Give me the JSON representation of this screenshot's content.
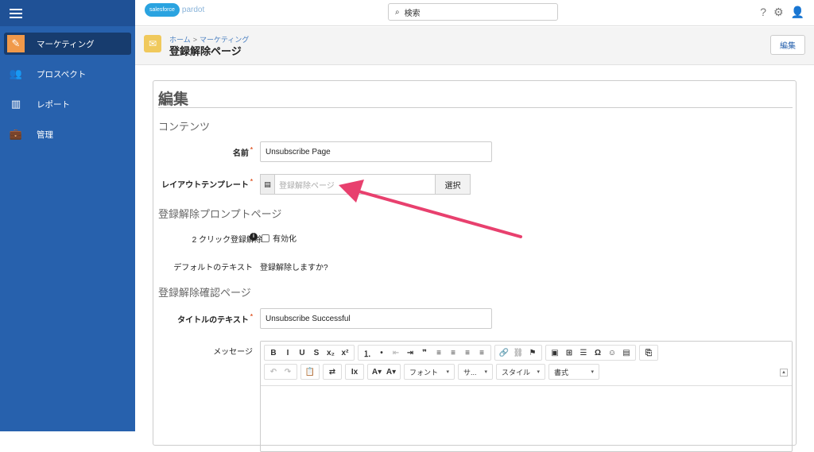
{
  "topbar": {
    "logo_cloud": "salesforce",
    "logo_product": "pardot",
    "search_placeholder": "検索",
    "help_icon": "?",
    "gear_icon": "⚙",
    "user_icon": "👤"
  },
  "sidebar": {
    "items": [
      {
        "label": "マーケティング",
        "icon": "✎",
        "active": true
      },
      {
        "label": "プロスペクト",
        "icon": "👥"
      },
      {
        "label": "レポート",
        "icon": "▥"
      },
      {
        "label": "管理",
        "icon": "💼"
      }
    ]
  },
  "header": {
    "breadcrumb": [
      "ホーム",
      "マーケティング"
    ],
    "breadcrumb_sep": ">",
    "title": "登録解除ページ",
    "edit_button": "編集"
  },
  "form": {
    "heading": "編集",
    "section_content": "コンテンツ",
    "name_label": "名前",
    "name_value": "Unsubscribe Page",
    "layout_label": "レイアウトテンプレート",
    "layout_placeholder": "登録解除ページ",
    "layout_select": "選択",
    "section_prompt": "登録解除プロンプトページ",
    "two_click_label": "2 クリック登録解除",
    "two_click_checkbox": "有効化",
    "default_text_label": "デフォルトのテキスト",
    "default_text_value": "登録解除しますか?",
    "section_confirm": "登録解除確認ページ",
    "title_label": "タイトルのテキスト",
    "title_value": "Unsubscribe Successful",
    "message_label": "メッセージ",
    "required_mark": "*"
  },
  "editor": {
    "row1": [
      [
        "B",
        "I",
        "U",
        "S",
        "x₂",
        "x²"
      ],
      [
        "⒈",
        "•",
        "⇤",
        "⇥",
        "❞",
        "≡",
        "≡",
        "≡",
        "≡"
      ],
      [
        "🔗",
        "⛓",
        "⚑"
      ],
      [
        "▣",
        "⊞",
        "☰",
        "Ω",
        "☺",
        "▤"
      ],
      [
        "⎘"
      ]
    ],
    "row2_buttons": [
      "↶",
      "↷",
      "📋",
      "⇄",
      "Ix",
      "A▾",
      "A▾"
    ],
    "combos": [
      "フォント",
      "サ...",
      "スタイル",
      "書式"
    ]
  },
  "colors": {
    "sidebar": "#2761ad",
    "accent_arrow": "#e8406e"
  }
}
